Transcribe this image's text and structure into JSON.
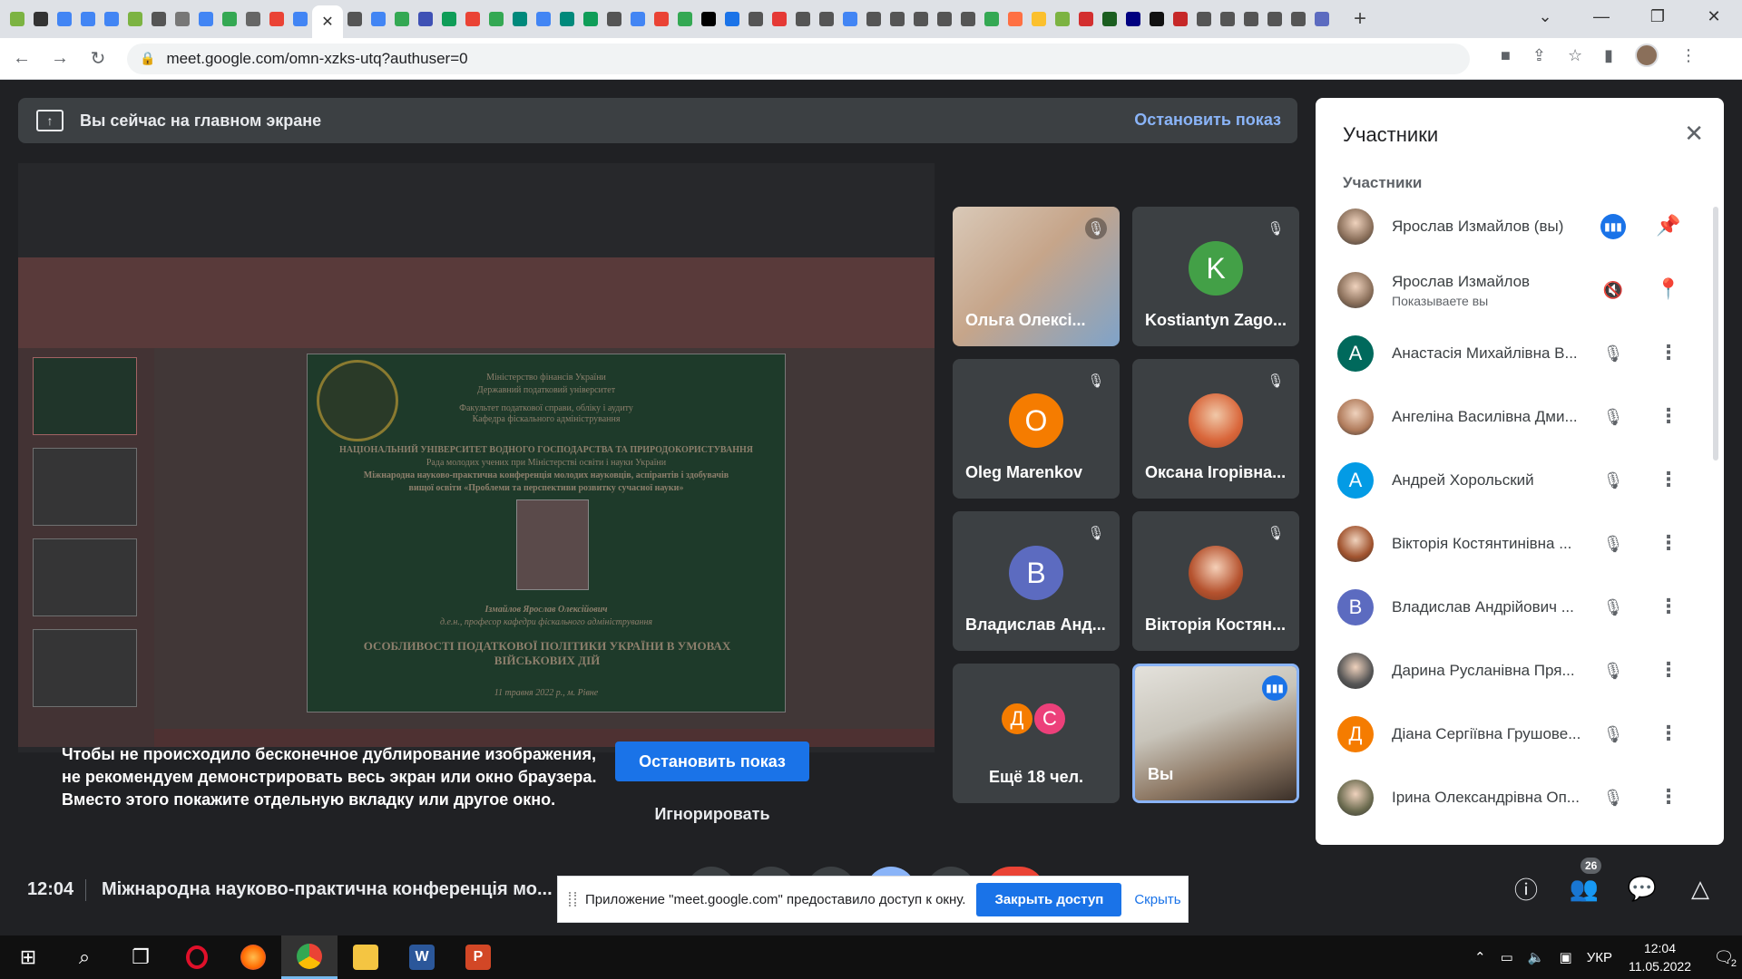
{
  "browser": {
    "url": "meet.google.com/omn-xzks-utq?authuser=0",
    "tab_favicons": [
      "#7cb342",
      "#333333",
      "#4285f4",
      "#4285f4",
      "#4285f4",
      "#7cb342",
      "#555555",
      "#777777",
      "#4285f4",
      "#34a853",
      "#666666",
      "#ea4335",
      "#4285f4"
    ],
    "tab_favicons_right": [
      "#555555",
      "#4285f4",
      "#34a853",
      "#3f51b5",
      "#0f9d58",
      "#ea4335",
      "#34a853",
      "#00897b",
      "#4285f4",
      "#00897b",
      "#0f9d58",
      "#555555",
      "#4285f4",
      "#ea4335",
      "#34a853",
      "#000000",
      "#1a73e8",
      "#555555",
      "#e53935",
      "#555555",
      "#555555",
      "#4285f4",
      "#555555",
      "#555555",
      "#555555",
      "#555555",
      "#555555",
      "#34a853",
      "#ff7043",
      "#fbc02d",
      "#7cb342",
      "#d32f2f",
      "#1b5e20",
      "#000080",
      "#111111",
      "#c62828",
      "#555555",
      "#555555",
      "#555555",
      "#555555",
      "#555555",
      "#5c6bc0"
    ],
    "close_tab_glyph": "✕",
    "new_tab_glyph": "+"
  },
  "banner": {
    "title": "Вы сейчас на главном экране",
    "stop_label": "Остановить показ"
  },
  "slide": {
    "line1": "Міністерство фінансів України",
    "line2": "Державний податковий університет",
    "line3": "Факультет податкової справи, обліку і аудиту",
    "line4": "Кафедра фіскального адміністрування",
    "line5": "НАЦІОНАЛЬНИЙ УНІВЕРСИТЕТ ВОДНОГО ГОСПОДАРСТВА ТА ПРИРОДОКОРИСТУВАННЯ",
    "line6": "Рада молодих учених при Міністерстві освіти і науки України",
    "line7": "Міжнародна науково-практична конференція молодих науковців, аспірантів і здобувачів",
    "line8": "вищої освіти «Проблеми та перспективи розвитку сучасної науки»",
    "author": "Ізмайлов Ярослав Олексійович",
    "author_role": "д.е.н., професор кафедри фіскального адміністрування",
    "title": "ОСОБЛИВОСТІ ПОДАТКОВОЇ ПОЛІТИКИ УКРАЇНИ В УМОВАХ ВІЙСЬКОВИХ ДІЙ",
    "date": "11 травня 2022 р., м. Рівне"
  },
  "warning": {
    "text": "Чтобы не происходило бесконечное дублирование изображения, не рекомендуем демонстрировать весь экран или окно браузера. Вместо этого покажите отдельную вкладку или другое окно.",
    "stop_label": "Остановить показ",
    "ignore_label": "Игнорировать"
  },
  "tiles": [
    {
      "name": "Ольга Олексі...",
      "photo": true
    },
    {
      "name": "Kostiantyn Zago...",
      "initial": "K",
      "color": "#43a047"
    },
    {
      "name": "Oleg Marenkov",
      "initial": "O",
      "color": "#f57c00"
    },
    {
      "name": "Оксана Ігорівна...",
      "photo": true
    },
    {
      "name": "Владислав Анд...",
      "initial": "В",
      "color": "#5c6bc0"
    },
    {
      "name": "Вікторія Костян...",
      "photo": true
    },
    {
      "name": "Ещё 18 чел.",
      "initials": [
        "Д",
        "С"
      ],
      "colors": [
        "#f57c00",
        "#ec407a"
      ]
    },
    {
      "name": "Вы",
      "photo": true
    }
  ],
  "panel": {
    "title": "Участники",
    "subtitle": "Участники",
    "close_glyph": "✕",
    "participants": [
      {
        "name": "Ярослав Измайлов (вы)",
        "note": "",
        "avatar": "photo",
        "color": "#8a6f5a"
      },
      {
        "name": "Ярослав Измайлов",
        "note": "Показываете вы",
        "avatar": "photo",
        "color": "#8a6f5a"
      },
      {
        "name": "Анастасія Михайлівна В...",
        "note": "",
        "initial": "А",
        "color": "#00695c"
      },
      {
        "name": "Ангеліна Василівна Дми...",
        "note": "",
        "avatar": "photo",
        "color": "#b07b5b"
      },
      {
        "name": "Андрей Хорольский",
        "note": "",
        "initial": "А",
        "color": "#039be5"
      },
      {
        "name": "Вікторія Костянтинівна ...",
        "note": "",
        "avatar": "photo",
        "color": "#a0522d"
      },
      {
        "name": "Владислав Андрійович ...",
        "note": "",
        "initial": "В",
        "color": "#5c6bc0"
      },
      {
        "name": "Дарина Русланівна Пря...",
        "note": "",
        "avatar": "photo",
        "color": "#555555"
      },
      {
        "name": "Діана Сергіївна Грушове...",
        "note": "",
        "initial": "Д",
        "color": "#f57c00"
      },
      {
        "name": "Ірина Олександрівна Оп...",
        "note": "",
        "avatar": "photo",
        "color": "#6b6b4f"
      }
    ]
  },
  "bottom": {
    "time": "12:04",
    "meeting_title": "Міжнародна науково-практична конференція мо...",
    "participants_count": "26"
  },
  "infobar": {
    "message": "Приложение \"meet.google.com\" предоставило доступ к окну.",
    "close_access_label": "Закрыть доступ",
    "hide_label": "Скрыть"
  },
  "taskbar": {
    "language": "УКР",
    "time": "12:04",
    "date": "11.05.2022",
    "notif_count": "2"
  }
}
